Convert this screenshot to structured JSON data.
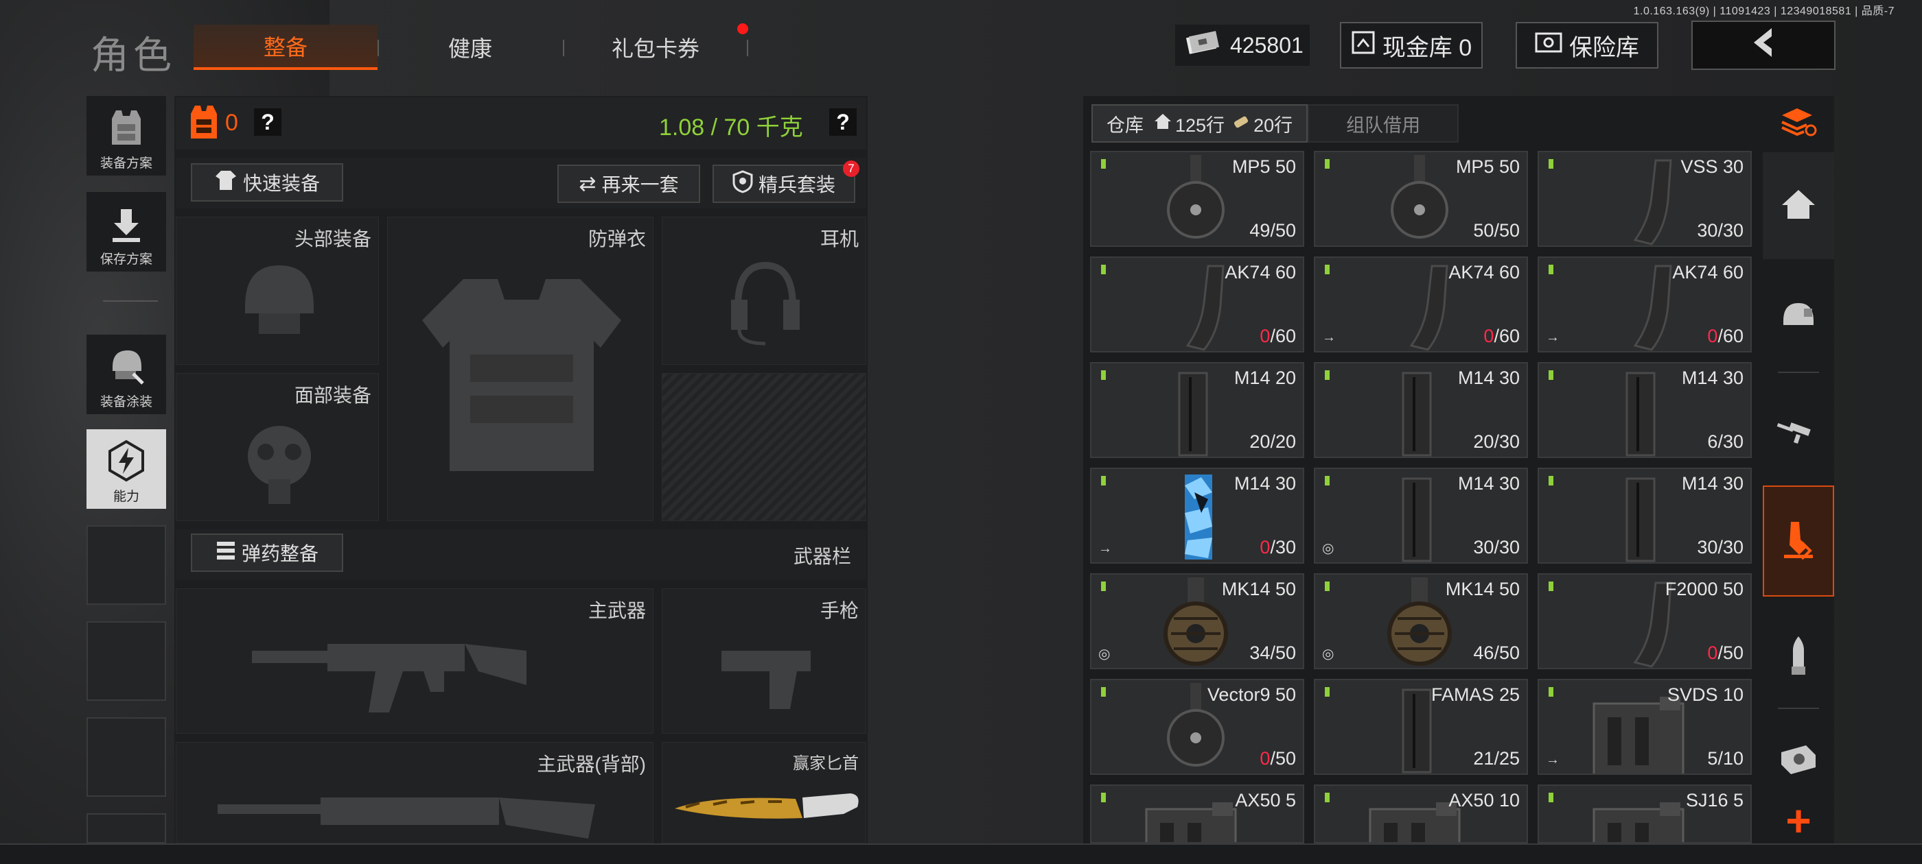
{
  "version": "1.0.163.163(9) | 11091423 | 12349018581 | 品质-7",
  "header": {
    "title": "角色",
    "tabs": [
      {
        "label": "整备",
        "active": true
      },
      {
        "label": "健康",
        "active": false
      },
      {
        "label": "礼包卡券",
        "active": false,
        "badge_dot": true
      }
    ],
    "money": "425801",
    "cash_vault": "现金库 0",
    "safe_label": "保险库"
  },
  "sidebar": {
    "items": [
      {
        "label": "装备方案",
        "icon": "vest-icon"
      },
      {
        "label": "保存方案",
        "icon": "download-icon"
      },
      {
        "label": "装备涂装",
        "icon": "helmet-skin-icon"
      },
      {
        "label": "能力",
        "icon": "lightning-icon",
        "active": true
      }
    ]
  },
  "loadout": {
    "armor_count": "0",
    "help": "?",
    "weight": "1.08 / 70 千克",
    "quick_equip": "快速装备",
    "again_set": "再来一套",
    "elite_set": "精兵套装",
    "elite_badge": "7",
    "slots": {
      "head": "头部装备",
      "armor": "防弹衣",
      "headset": "耳机",
      "face": "面部装备",
      "primary": "主武器",
      "pistol": "手枪",
      "primary_back": "主武器(背部)",
      "knife": "赢家匕首"
    },
    "ammo_equip": "弹药整备",
    "weapon_bar": "武器栏"
  },
  "inventory": {
    "tab_warehouse": "仓库",
    "rows_home": "125行",
    "rows_ammo": "20行",
    "tab_team": "组队借用",
    "items": [
      {
        "name": "MP5 50",
        "cur": "49",
        "max": "/50",
        "zero": false,
        "type": "drum",
        "mark": ""
      },
      {
        "name": "MP5 50",
        "cur": "50",
        "max": "/50",
        "zero": false,
        "type": "drum",
        "mark": ""
      },
      {
        "name": "VSS 30",
        "cur": "30",
        "max": "/30",
        "zero": false,
        "type": "curve",
        "mark": ""
      },
      {
        "name": "AK74 60",
        "cur": "0",
        "max": "/60",
        "zero": true,
        "type": "curve",
        "mark": ""
      },
      {
        "name": "AK74 60",
        "cur": "0",
        "max": "/60",
        "zero": true,
        "type": "curve",
        "mark": "→"
      },
      {
        "name": "AK74 60",
        "cur": "0",
        "max": "/60",
        "zero": true,
        "type": "curve",
        "mark": "→"
      },
      {
        "name": "M14 20",
        "cur": "20",
        "max": "/20",
        "zero": false,
        "type": "straight",
        "mark": ""
      },
      {
        "name": "M14 30",
        "cur": "20",
        "max": "/30",
        "zero": false,
        "type": "straight",
        "mark": ""
      },
      {
        "name": "M14 30",
        "cur": "6",
        "max": "/30",
        "zero": false,
        "type": "straight",
        "mark": ""
      },
      {
        "name": "M14 30",
        "cur": "0",
        "max": "/30",
        "zero": true,
        "type": "blue",
        "mark": "→"
      },
      {
        "name": "M14 30",
        "cur": "30",
        "max": "/30",
        "zero": false,
        "type": "straight",
        "mark": "◎"
      },
      {
        "name": "M14 30",
        "cur": "30",
        "max": "/30",
        "zero": false,
        "type": "straight",
        "mark": ""
      },
      {
        "name": "MK14 50",
        "cur": "34",
        "max": "/50",
        "zero": false,
        "type": "bigdrum",
        "mark": "◎"
      },
      {
        "name": "MK14 50",
        "cur": "46",
        "max": "/50",
        "zero": false,
        "type": "bigdrum",
        "mark": "◎"
      },
      {
        "name": "F2000 50",
        "cur": "0",
        "max": "/50",
        "zero": true,
        "type": "curve",
        "mark": ""
      },
      {
        "name": "Vector9 50",
        "cur": "0",
        "max": "/50",
        "zero": true,
        "type": "drum",
        "mark": ""
      },
      {
        "name": "FAMAS 25",
        "cur": "21",
        "max": "/25",
        "zero": false,
        "type": "straight",
        "mark": ""
      },
      {
        "name": "SVDS 10",
        "cur": "5",
        "max": "/10",
        "zero": false,
        "type": "box",
        "mark": "→"
      },
      {
        "name": "AX50 5",
        "cur": "",
        "max": "",
        "zero": false,
        "type": "box",
        "mark": ""
      },
      {
        "name": "AX50 10",
        "cur": "",
        "max": "",
        "zero": false,
        "type": "box",
        "mark": ""
      },
      {
        "name": "SJ16 5",
        "cur": "",
        "max": "",
        "zero": false,
        "type": "box",
        "mark": ""
      }
    ]
  },
  "rail": {
    "plus": "+"
  },
  "colors": {
    "accent": "#ff5a10",
    "weight_green": "#8fd13a",
    "zero_red": "#ff2a4a",
    "tag_green": "#8fd13a"
  }
}
